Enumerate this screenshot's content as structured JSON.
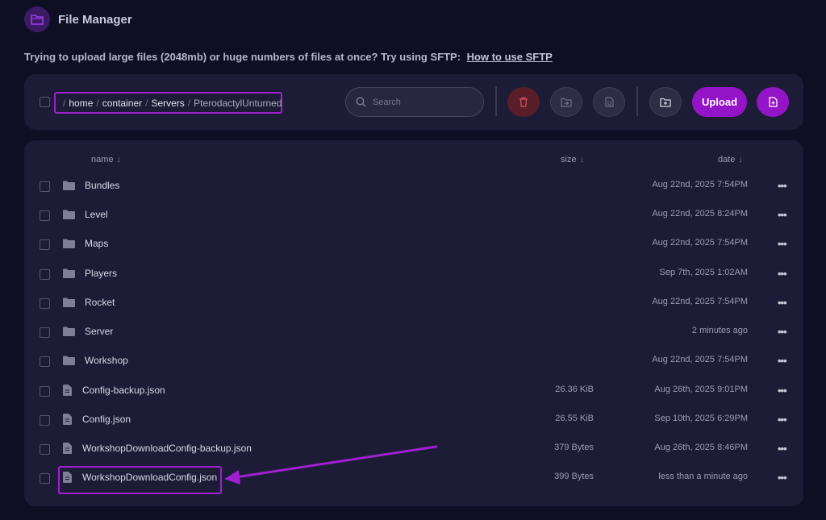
{
  "header": {
    "title": "File Manager",
    "icon": "folder-icon"
  },
  "notice": {
    "text": "Trying to upload large files (2048mb) or huge numbers of files at once? Try using SFTP:",
    "link": "How to use SFTP"
  },
  "breadcrumb": {
    "segments": [
      "home",
      "container",
      "Servers",
      "PterodactylUnturned"
    ],
    "separator": "/"
  },
  "search": {
    "placeholder": "Search"
  },
  "toolbar": {
    "upload_label": "Upload"
  },
  "table": {
    "columns": {
      "name": "name",
      "size": "size",
      "date": "date",
      "sort_arrow": "↓"
    },
    "rows": [
      {
        "type": "folder",
        "name": "Bundles",
        "size": "",
        "date": "Aug 22nd, 2025 7:54PM"
      },
      {
        "type": "folder",
        "name": "Level",
        "size": "",
        "date": "Aug 22nd, 2025 8:24PM"
      },
      {
        "type": "folder",
        "name": "Maps",
        "size": "",
        "date": "Aug 22nd, 2025 7:54PM"
      },
      {
        "type": "folder",
        "name": "Players",
        "size": "",
        "date": "Sep 7th, 2025 1:02AM"
      },
      {
        "type": "folder",
        "name": "Rocket",
        "size": "",
        "date": "Aug 22nd, 2025 7:54PM"
      },
      {
        "type": "folder",
        "name": "Server",
        "size": "",
        "date": "2 minutes ago"
      },
      {
        "type": "folder",
        "name": "Workshop",
        "size": "",
        "date": "Aug 22nd, 2025 7:54PM"
      },
      {
        "type": "file",
        "name": "Config-backup.json",
        "size": "26.36 KiB",
        "date": "Aug 26th, 2025 9:01PM"
      },
      {
        "type": "file",
        "name": "Config.json",
        "size": "26.55 KiB",
        "date": "Sep 10th, 2025 6:29PM"
      },
      {
        "type": "file",
        "name": "WorkshopDownloadConfig-backup.json",
        "size": "379 Bytes",
        "date": "Aug 26th, 2025 8:46PM"
      },
      {
        "type": "file",
        "name": "WorkshopDownloadConfig.json",
        "size": "399 Bytes",
        "date": "less than a minute ago"
      }
    ],
    "more_label": "•••"
  },
  "colors": {
    "accent": "#9414c8",
    "background": "#0e0e24",
    "panel": "#1c1c36",
    "annotation": "#a020d0"
  }
}
